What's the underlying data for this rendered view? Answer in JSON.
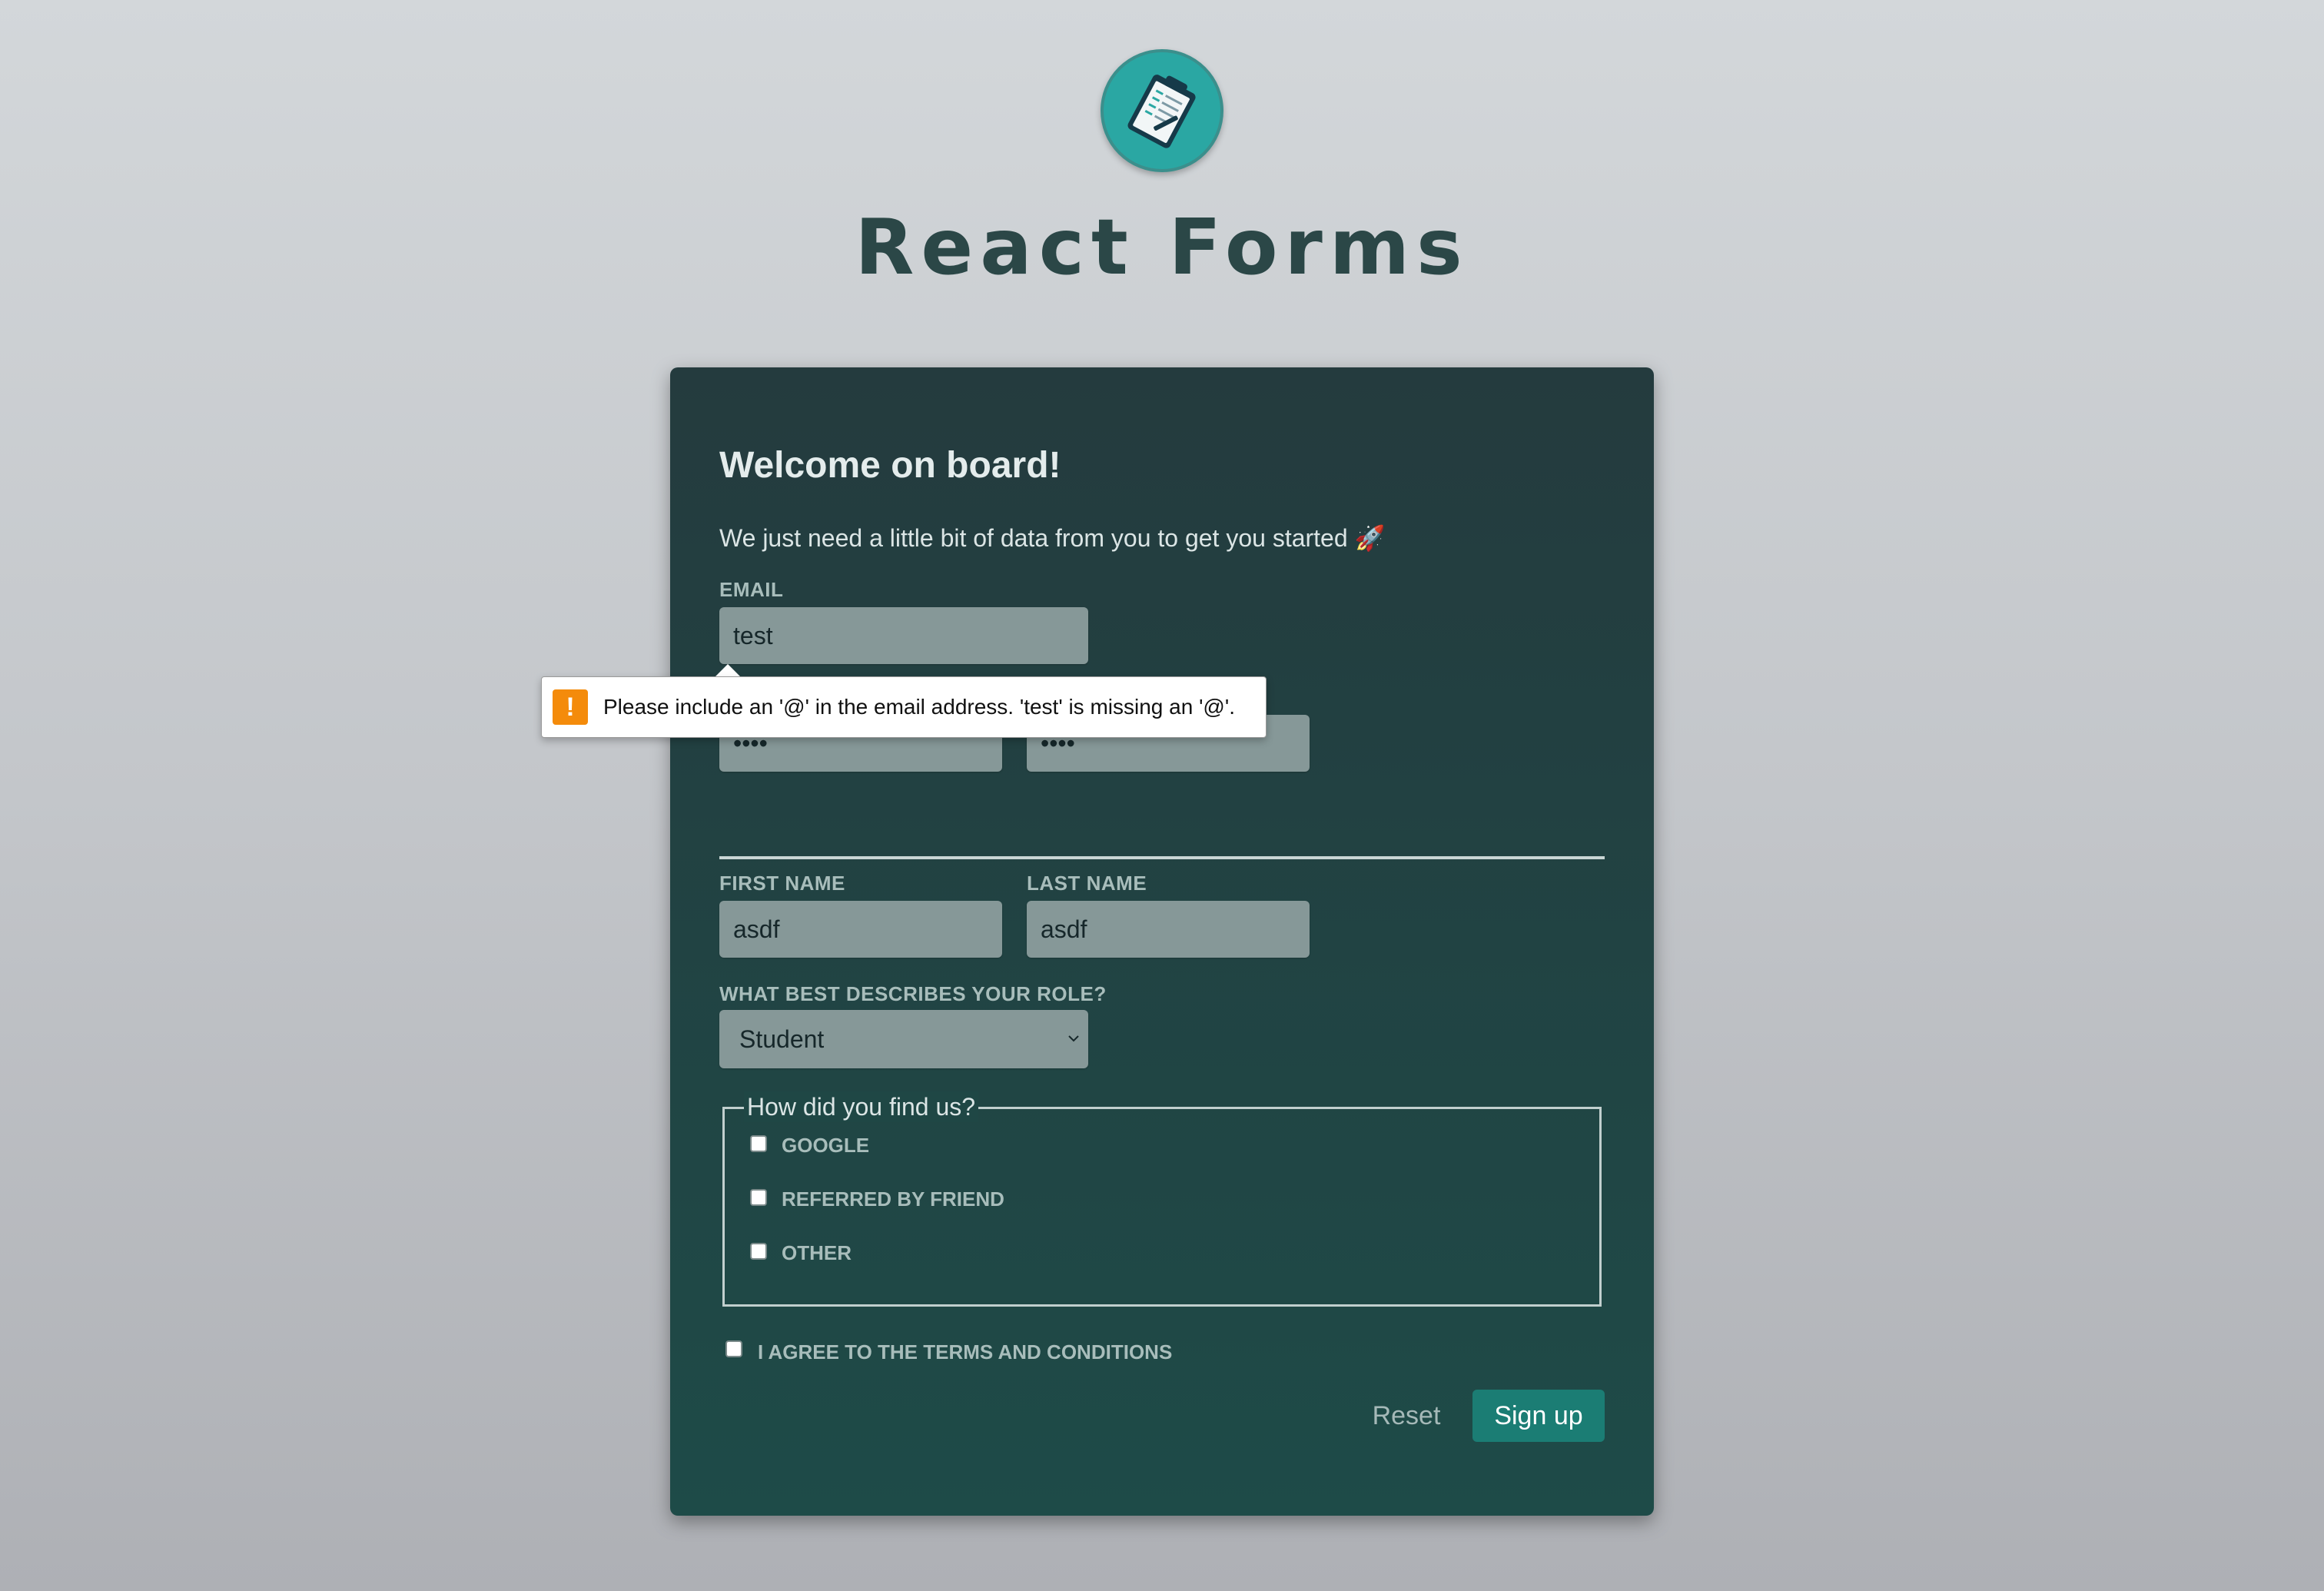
{
  "app": {
    "title": "React Forms",
    "logo_icon": "clipboard-icon"
  },
  "form": {
    "heading": "Welcome on board!",
    "subtitle": "We just need a little bit of data from you to get you started 🚀",
    "email": {
      "label": "EMAIL",
      "value": "test"
    },
    "password": {
      "value": "••••"
    },
    "password_confirm": {
      "value": "••••"
    },
    "first_name": {
      "label": "FIRST NAME",
      "value": "asdf"
    },
    "last_name": {
      "label": "LAST NAME",
      "value": "asdf"
    },
    "role": {
      "label": "WHAT BEST DESCRIBES YOUR ROLE?",
      "selected": "Student"
    },
    "referral": {
      "legend": "How did you find us?",
      "options": [
        {
          "label": "GOOGLE",
          "checked": false
        },
        {
          "label": "REFERRED BY FRIEND",
          "checked": false
        },
        {
          "label": "OTHER",
          "checked": false
        }
      ]
    },
    "terms": {
      "label": "I AGREE TO THE TERMS AND CONDITIONS",
      "checked": false
    },
    "reset_label": "Reset",
    "submit_label": "Sign up"
  },
  "validation_tooltip": {
    "icon": "warning-icon",
    "message": "Please include an '@' in the email address. 'test' is missing an '@'."
  },
  "colors": {
    "card_bg": "#1e4b48",
    "accent": "#1b7d74",
    "title": "#2b4747",
    "warning": "#f48b0b"
  }
}
